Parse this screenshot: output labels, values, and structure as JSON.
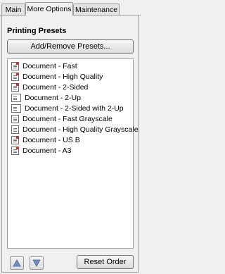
{
  "tabs": [
    {
      "label": "Main",
      "active": false
    },
    {
      "label": "More Options",
      "active": true
    },
    {
      "label": "Maintenance",
      "active": false
    }
  ],
  "section_title": "Printing Presets",
  "buttons": {
    "add_remove": "Add/Remove Presets...",
    "reset_order": "Reset Order"
  },
  "presets": [
    {
      "label": "Document - Fast",
      "icon": "document-icon"
    },
    {
      "label": "Document - High Quality",
      "icon": "document-icon"
    },
    {
      "label": "Document - 2-Sided",
      "icon": "document-icon"
    },
    {
      "label": "Document - 2-Up",
      "icon": "two-up-icon"
    },
    {
      "label": "Document - 2-Sided with 2-Up",
      "icon": "two-up-icon"
    },
    {
      "label": "Document - Fast Grayscale",
      "icon": "document-icon"
    },
    {
      "label": "Document - High Quality Grayscale",
      "icon": "document-icon"
    },
    {
      "label": "Document - US B",
      "icon": "document-icon"
    },
    {
      "label": "Document - A3",
      "icon": "document-icon"
    }
  ],
  "colors": {
    "arrow": "#6f8fc4"
  }
}
